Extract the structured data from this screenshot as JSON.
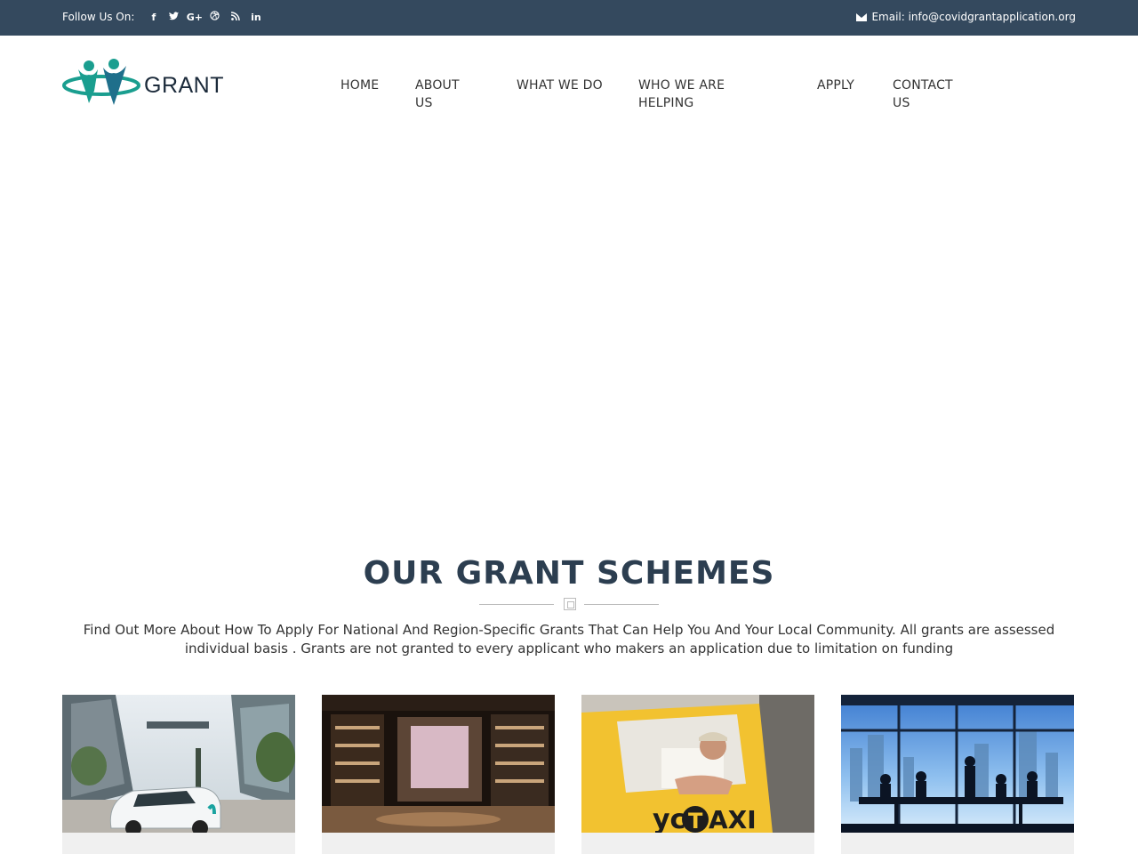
{
  "topbar": {
    "follow_label": "Follow Us On:",
    "social_icons": [
      {
        "name": "facebook-icon",
        "glyph": "f"
      },
      {
        "name": "twitter-icon",
        "glyph": "t"
      },
      {
        "name": "google-plus-icon",
        "glyph": "G+"
      },
      {
        "name": "dribbble-icon",
        "glyph": "⊛"
      },
      {
        "name": "rss-icon",
        "glyph": "◔"
      },
      {
        "name": "linkedin-icon",
        "glyph": "in"
      }
    ],
    "email_text": "Email: info@covidgrantapplication.org"
  },
  "header": {
    "logo_text": "GRANT"
  },
  "nav": {
    "home": "HOME",
    "about_1": "ABOUT",
    "about_2": "US",
    "what_we_do": "WHAT WE DO",
    "who_1": "WHO WE ARE",
    "who_2": "HELPING",
    "apply": "APPLY",
    "contact_1": "CONTACT",
    "contact_2": "US"
  },
  "section": {
    "title": "OUR GRANT SCHEMES",
    "description": "Find Out More About How To Apply For National And Region-Specific Grants That Can Help You And Your Local Community. All grants are assessed individual basis . Grants are not granted to every applicant who makers an application due to limitation on funding"
  },
  "cards": [
    {
      "image": "self-driving-car-street"
    },
    {
      "image": "shoe-store-interior"
    },
    {
      "image": "taxi-driver"
    },
    {
      "image": "business-meeting-silhouettes"
    }
  ],
  "colors": {
    "topbar_bg": "#34495e",
    "title": "#2c3e50",
    "logo_teal": "#1a9e8f"
  }
}
